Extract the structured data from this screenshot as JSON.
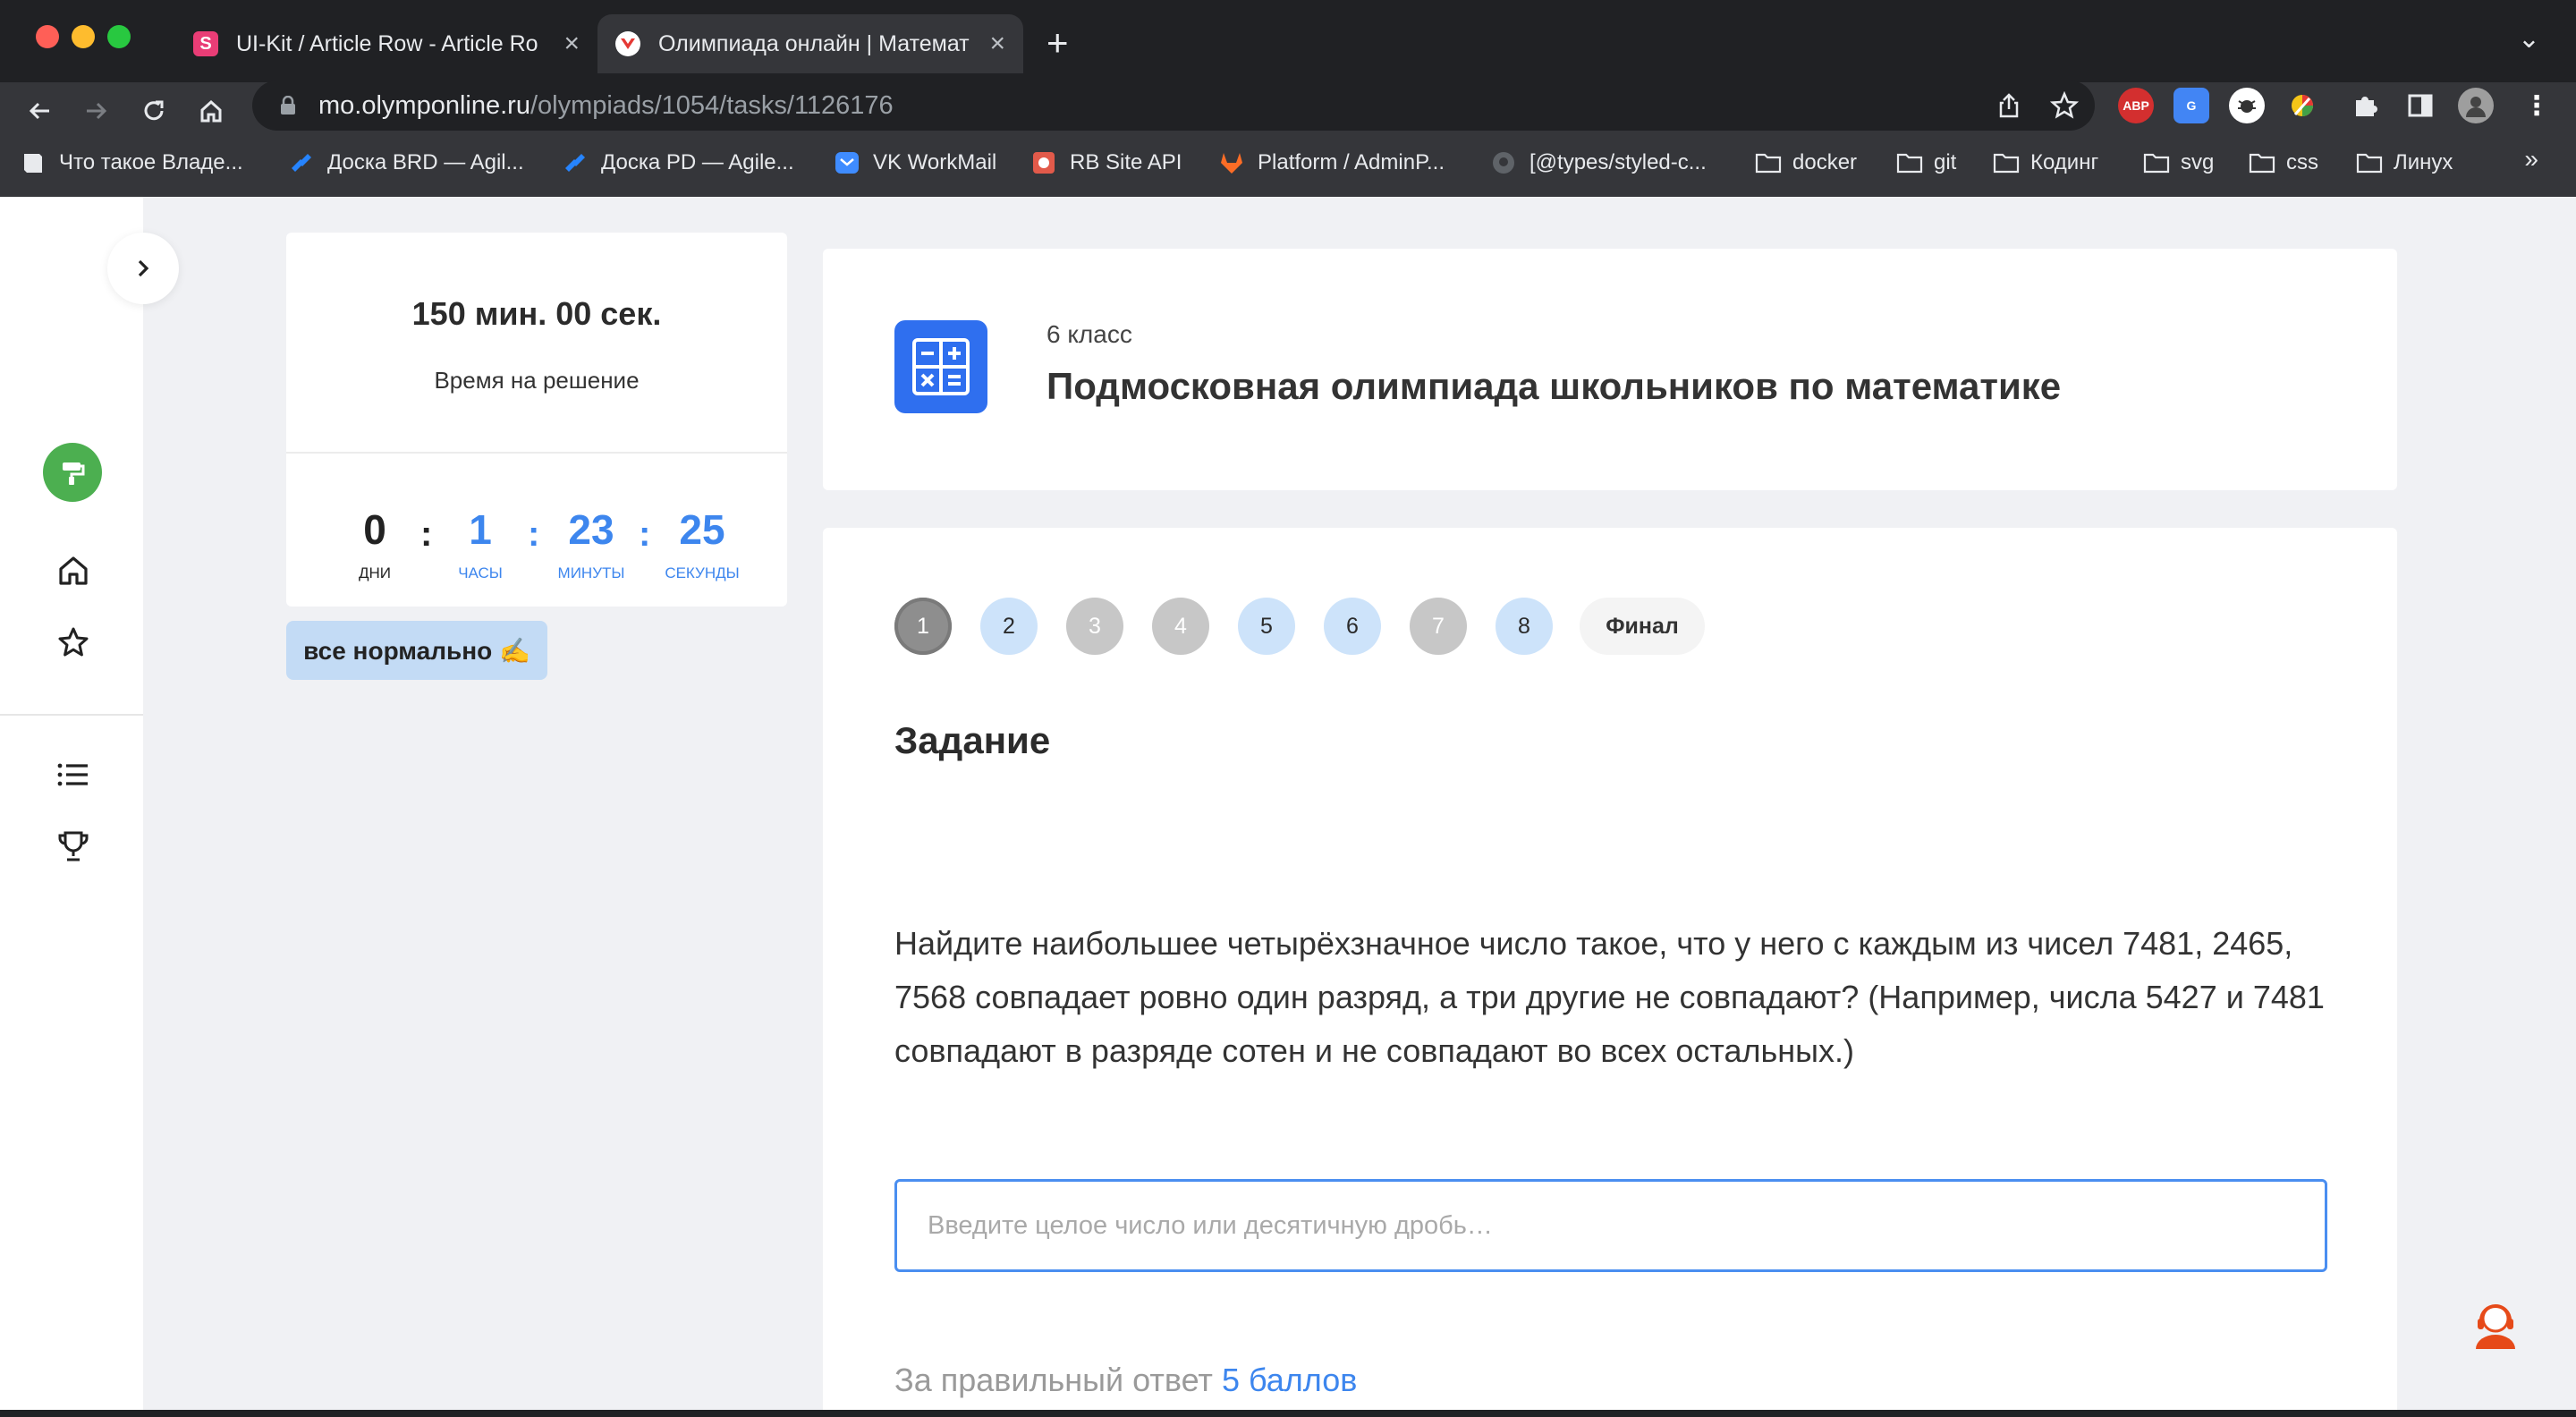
{
  "browser": {
    "tabs": [
      {
        "title": "UI-Kit / Article Row - Article Ro",
        "favicon": "s-brand-icon",
        "active": false
      },
      {
        "title": "Олимпиада онлайн | Математ",
        "favicon": "olymp-logo-icon",
        "active": true
      }
    ],
    "url_host": "mo.olymponline.ru",
    "url_path": "/olympiads/1054/tasks/1126176",
    "bookmarks": [
      "Что такое Владе...",
      "Доска BRD — Agil...",
      "Доска PD — Agile...",
      "VK WorkMail",
      "RB Site API",
      "Platform / AdminP...",
      "[@types/styled-c...",
      "docker",
      "git",
      "Кодинг",
      "svg",
      "css",
      "Линух"
    ],
    "extensions": [
      "ABP"
    ]
  },
  "timer": {
    "total": "150 мин. 00 сек.",
    "caption": "Время на решение",
    "countdown": [
      {
        "value": "0",
        "label": "дни"
      },
      {
        "value": "1",
        "label": "часы"
      },
      {
        "value": "23",
        "label": "минуты"
      },
      {
        "value": "25",
        "label": "секунды"
      }
    ]
  },
  "status_chip": "все нормально ✍️",
  "olympiad": {
    "grade": "6 класс",
    "title": "Подмосковная олимпиада школьников по математике"
  },
  "task_nav": {
    "items": [
      {
        "label": "1",
        "state": "current"
      },
      {
        "label": "2",
        "state": "todo"
      },
      {
        "label": "3",
        "state": "done"
      },
      {
        "label": "4",
        "state": "done"
      },
      {
        "label": "5",
        "state": "todo"
      },
      {
        "label": "6",
        "state": "todo"
      },
      {
        "label": "7",
        "state": "done"
      },
      {
        "label": "8",
        "state": "todo"
      }
    ],
    "final_label": "Финал"
  },
  "task": {
    "heading": "Задание",
    "text": "Найдите наибольшее четырёхзначное число такое, что у него с каждым из чисел 7481, 2465, 7568 совпадает ровно один разряд, а три другие не совпадают? (Например, числа 5427 и 7481 совпадают в разряде сотен и не совпадают во всех остальных.)",
    "answer_placeholder": "Введите целое число или десятичную дробь…",
    "answer_value": "",
    "points_prefix": "За правильный ответ",
    "points_value": "5 баллов"
  },
  "colors": {
    "accent": "#3d86ee",
    "primary_icon": "#2f6fef",
    "avatar": "#4caf50",
    "chip": "#c3dbf5"
  }
}
